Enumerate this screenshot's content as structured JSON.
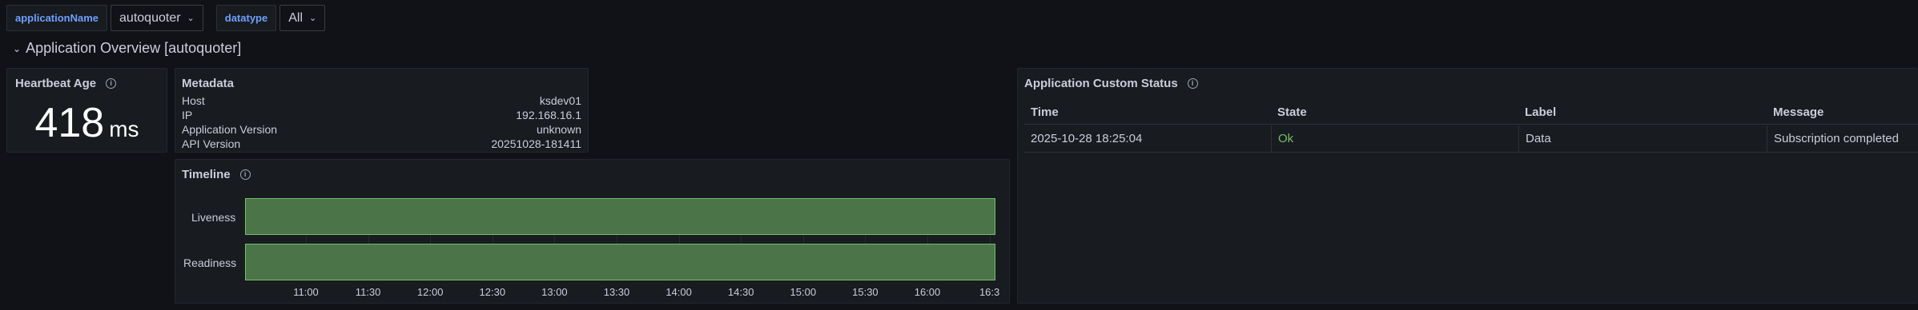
{
  "variables": [
    {
      "label": "applicationName",
      "value": "autoquoter"
    },
    {
      "label": "datatype",
      "value": "All"
    }
  ],
  "row": {
    "title": "Application Overview [autoquoter]"
  },
  "heartbeat": {
    "title": "Heartbeat Age",
    "value": "418",
    "unit": "ms"
  },
  "metadata": {
    "title": "Metadata",
    "items": [
      {
        "key": "Host",
        "value": "ksdev01"
      },
      {
        "key": "IP",
        "value": "192.168.16.1"
      },
      {
        "key": "Application Version",
        "value": "unknown"
      },
      {
        "key": "API Version",
        "value": "20251028-181411"
      }
    ]
  },
  "timeline": {
    "title": "Timeline",
    "rows": [
      "Liveness",
      "Readiness"
    ],
    "ticks": [
      "11:00",
      "11:30",
      "12:00",
      "12:30",
      "13:00",
      "13:30",
      "14:00",
      "14:30",
      "15:00",
      "15:30",
      "16:00",
      "16:3"
    ],
    "bar_color": "#4b7448",
    "bar_border": "#73bf69"
  },
  "custom_status": {
    "title": "Application Custom Status",
    "columns": [
      "Time",
      "State",
      "Label",
      "Message"
    ],
    "rows": [
      {
        "time": "2025-10-28 18:25:04",
        "state": "Ok",
        "label": "Data",
        "message": "Subscription completed"
      }
    ]
  },
  "colors": {
    "background": "#111217",
    "panel": "#181b1f",
    "accent_blue": "#6e9fff",
    "ok_green": "#73bf69"
  }
}
